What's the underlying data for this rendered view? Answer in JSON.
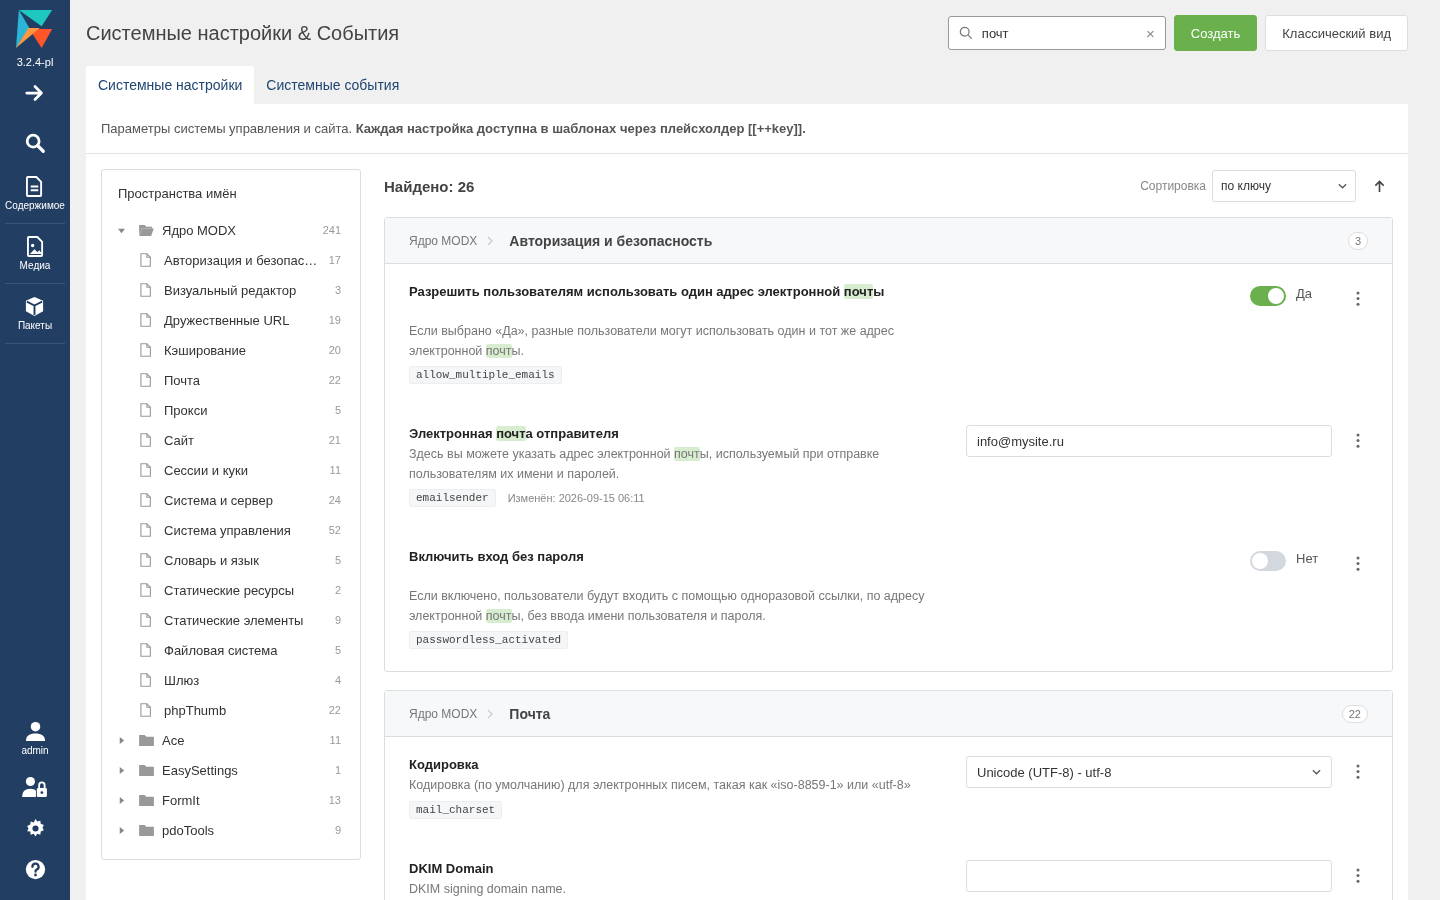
{
  "sidebar": {
    "version": "3.2.4-pl",
    "items": [
      {
        "kind": "arrow"
      },
      {
        "kind": "search"
      },
      {
        "kind": "content",
        "label": "Содержимое"
      },
      {
        "kind": "media",
        "label": "Медиа"
      },
      {
        "kind": "packages",
        "label": "Пакеты"
      }
    ],
    "bottom_items": [
      {
        "kind": "user",
        "label": "admin"
      },
      {
        "kind": "access"
      },
      {
        "kind": "settings"
      },
      {
        "kind": "help"
      }
    ]
  },
  "page_title": "Системные настройки & События",
  "search": {
    "value": "почт",
    "clear": "×"
  },
  "buttons": [
    {
      "label": "Создать",
      "kind": "primary"
    },
    {
      "label": "Классический вид",
      "kind": "default"
    }
  ],
  "tabs": [
    {
      "label": "Системные настройки",
      "selected": true
    },
    {
      "label": "Системные события",
      "selected": false
    }
  ],
  "intro": "Параметры системы управления и сайта. **Каждая настройка доступна в шаблонах через плейсхолдер [[++key]].**",
  "tree": {
    "title": "Пространства имён",
    "items": [
      {
        "label": "Ядро MODX",
        "count": "241",
        "expanded": true,
        "children": [
          {
            "label": "Авторизация и безопас…",
            "count": "17"
          },
          {
            "label": "Визуальный редактор",
            "count": "3"
          },
          {
            "label": "Дружественные URL",
            "count": "19"
          },
          {
            "label": "Кэширование",
            "count": "20"
          },
          {
            "label": "Почта",
            "count": "22"
          },
          {
            "label": "Прокси",
            "count": "5"
          },
          {
            "label": "Сайт",
            "count": "21"
          },
          {
            "label": "Сессии и куки",
            "count": "11"
          },
          {
            "label": "Система и сервер",
            "count": "24"
          },
          {
            "label": "Система управления",
            "count": "52"
          },
          {
            "label": "Словарь и язык",
            "count": "5"
          },
          {
            "label": "Статические ресурсы",
            "count": "2"
          },
          {
            "label": "Статические элементы",
            "count": "9"
          },
          {
            "label": "Файловая система",
            "count": "5"
          },
          {
            "label": "Шлюз",
            "count": "4"
          },
          {
            "label": "phpThumb",
            "count": "22"
          }
        ]
      },
      {
        "label": "Ace",
        "count": "11",
        "expanded": false
      },
      {
        "label": "EasySettings",
        "count": "1",
        "expanded": false
      },
      {
        "label": "FormIt",
        "count": "13",
        "expanded": false
      },
      {
        "label": "pdoTools",
        "count": "9",
        "expanded": false
      }
    ]
  },
  "found": "Найдено: 26",
  "sort": {
    "label": "Сортировка",
    "value": "по ключу"
  },
  "groups": [
    {
      "namespace": "Ядро MODX",
      "area": "Авторизация и безопасность",
      "count": "3",
      "settings": [
        {
          "kind": "toggle",
          "on": true,
          "value": "Да",
          "title": [
            {
              "text": "Разрешить пользователям использовать один адрес электронной ",
              "highlight": false
            },
            {
              "text": "почт",
              "highlight": true
            },
            {
              "text": "ы",
              "highlight": false
            }
          ],
          "description": [
            {
              "text": "Если выбрано «Да», разные пользователи могут использовать один и тот же адрес электронной ",
              "highlight": false
            },
            {
              "text": "почт",
              "highlight": true
            },
            {
              "text": "ы.",
              "highlight": false
            }
          ],
          "key": "allow_multiple_emails"
        },
        {
          "kind": "text",
          "value": "info@mysite.ru",
          "title": [
            {
              "text": "Электронная ",
              "highlight": false
            },
            {
              "text": "почт",
              "highlight": true
            },
            {
              "text": "а отправителя",
              "highlight": false
            }
          ],
          "description": [
            {
              "text": "Здесь вы можете указать адрес электронной ",
              "highlight": false
            },
            {
              "text": "почт",
              "highlight": true
            },
            {
              "text": "ы, используемый при отправке пользователям их имени и паролей.",
              "highlight": false
            }
          ],
          "key": "emailsender",
          "modified": "Изменён: 2026-09-15 06:11"
        },
        {
          "kind": "toggle",
          "on": false,
          "value": "Нет",
          "title": [
            {
              "text": "Включить вход без пароля",
              "highlight": false
            }
          ],
          "description": [
            {
              "text": "Если включено, пользователи будут входить с помощью одноразовой ссылки, по адресу электронной ",
              "highlight": false
            },
            {
              "text": "почт",
              "highlight": true
            },
            {
              "text": "ы, без ввода имени пользователя и пароля.",
              "highlight": false
            }
          ],
          "key": "passwordless_activated"
        }
      ]
    },
    {
      "namespace": "Ядро MODX",
      "area": "Почта",
      "count": "22",
      "settings": [
        {
          "kind": "select",
          "value": "Unicode (UTF-8) - utf-8",
          "title": [
            {
              "text": "Кодировка",
              "highlight": false
            }
          ],
          "description": [
            {
              "text": "Кодировка (по умолчанию) для электронных писем, такая как «iso-8859-1» или «utf-8»",
              "highlight": false
            }
          ],
          "key": "mail_charset"
        },
        {
          "kind": "text",
          "title": [
            {
              "text": "DKIM Domain",
              "highlight": false
            }
          ],
          "description": [
            {
              "text": "DKIM signing domain name.",
              "highlight": false
            }
          ]
        }
      ]
    }
  ]
}
